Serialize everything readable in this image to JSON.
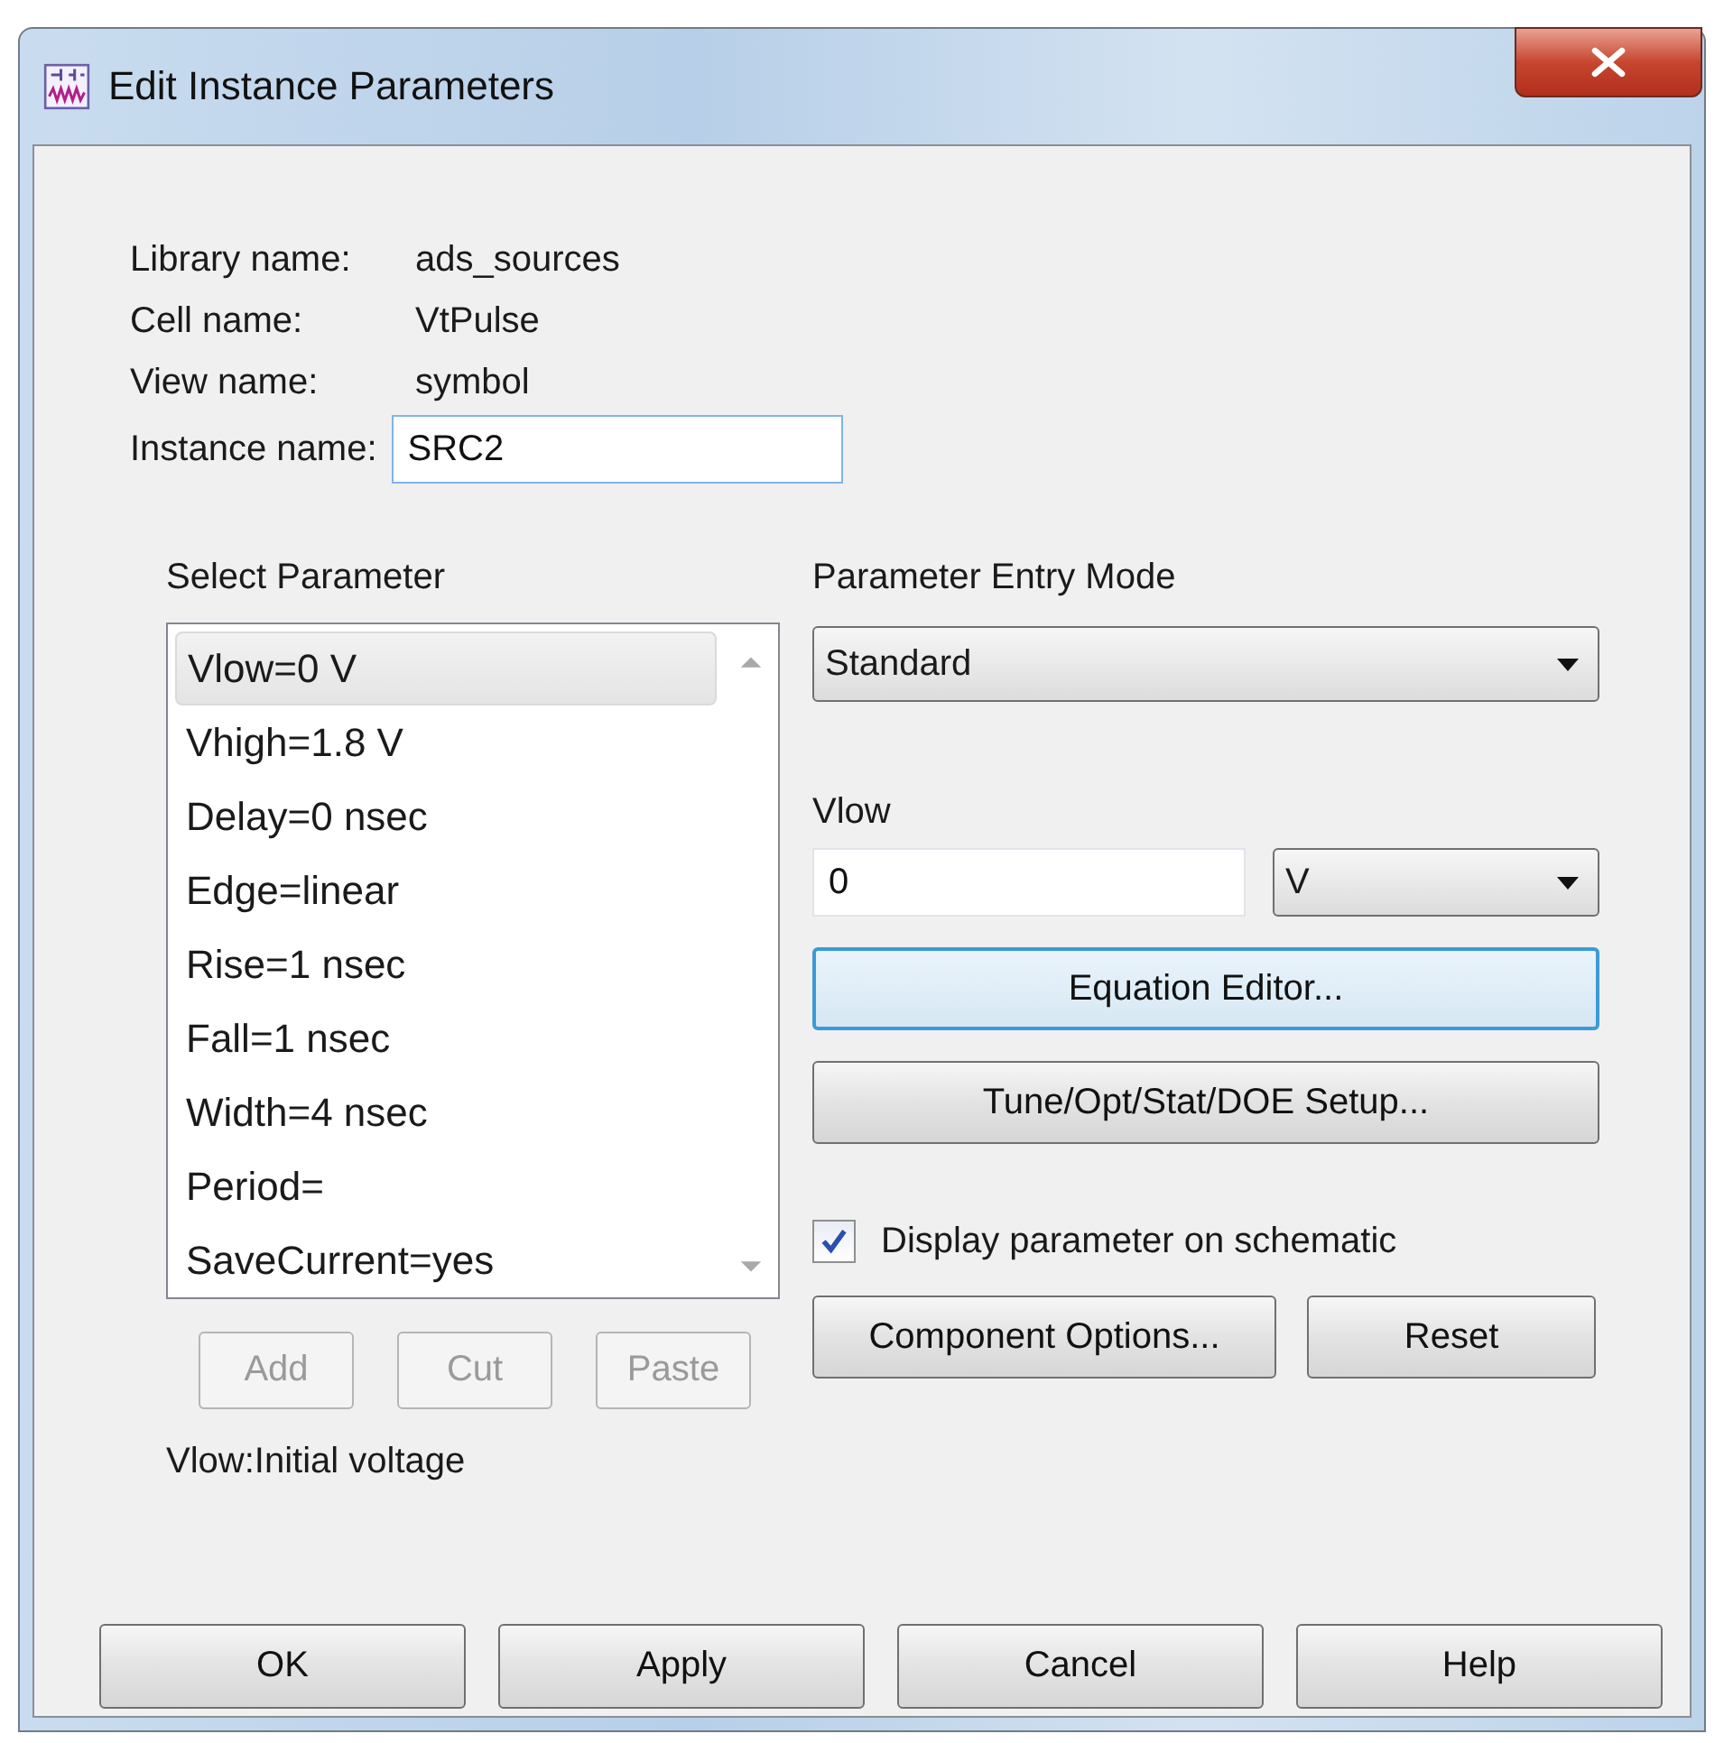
{
  "window": {
    "title": "Edit Instance Parameters"
  },
  "info": [
    {
      "label": "Library name:",
      "value": "ads_sources"
    },
    {
      "label": "Cell name:",
      "value": "VtPulse"
    },
    {
      "label": "View name:",
      "value": "symbol"
    }
  ],
  "instance_name": {
    "label": "Instance name:",
    "value": "SRC2"
  },
  "parameters": {
    "heading": "Select Parameter",
    "items": [
      {
        "text": "Vlow=0 V",
        "selected": true
      },
      {
        "text": "Vhigh=1.8 V",
        "selected": false
      },
      {
        "text": "Delay=0 nsec",
        "selected": false
      },
      {
        "text": "Edge=linear",
        "selected": false
      },
      {
        "text": "Rise=1 nsec",
        "selected": false
      },
      {
        "text": "Fall=1 nsec",
        "selected": false
      },
      {
        "text": "Width=4 nsec",
        "selected": false
      },
      {
        "text": "Period=",
        "selected": false
      },
      {
        "text": "SaveCurrent=yes",
        "selected": false
      }
    ]
  },
  "list_buttons": [
    {
      "label": "Add",
      "disabled": true
    },
    {
      "label": "Cut",
      "disabled": true
    },
    {
      "label": "Paste",
      "disabled": true
    }
  ],
  "description": "Vlow:Initial voltage",
  "entry_mode": {
    "heading": "Parameter Entry Mode",
    "value": "Standard"
  },
  "parameter_value": {
    "label": "Vlow",
    "value": "0",
    "unit": "V"
  },
  "action_buttons": [
    {
      "label": "Equation Editor...",
      "focused": true
    },
    {
      "label": "Tune/Opt/Stat/DOE Setup...",
      "focused": false
    }
  ],
  "display_checkbox": {
    "label": "Display parameter on schematic",
    "checked": true
  },
  "option_buttons": [
    {
      "label": "Component Options..."
    },
    {
      "label": "Reset"
    }
  ],
  "dialog_buttons": [
    {
      "label": "OK"
    },
    {
      "label": "Apply"
    },
    {
      "label": "Cancel"
    },
    {
      "label": "Help"
    }
  ]
}
